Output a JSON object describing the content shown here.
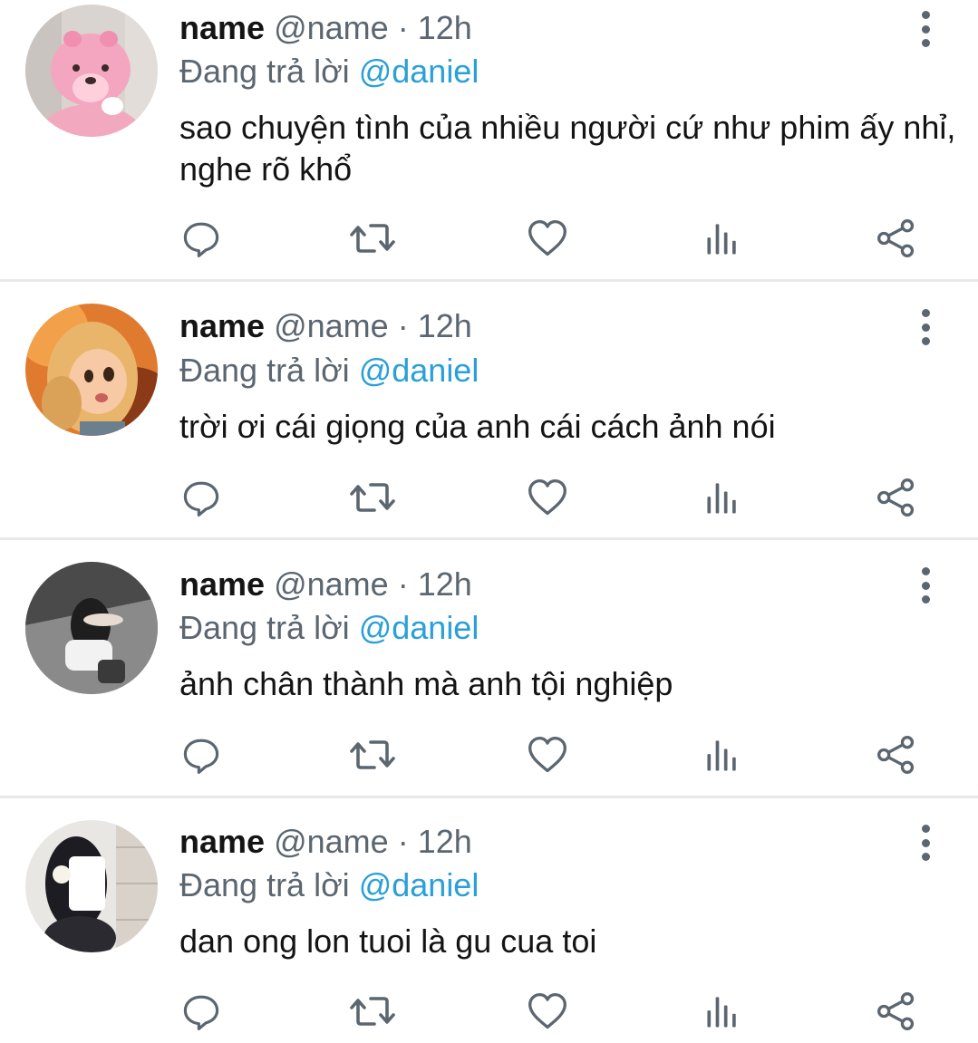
{
  "colors": {
    "name": "#141414",
    "secondary": "#5b6670",
    "mention": "#2a9fd8",
    "divider": "#e6e8ea",
    "icon": "#5b6670"
  },
  "actions": {
    "reply": "reply-icon",
    "retweet": "retweet-icon",
    "like": "heart-icon",
    "views": "views-icon",
    "share": "share-icon",
    "more": "more-vertical-icon"
  },
  "tweets": [
    {
      "name": "name",
      "handle": "@name",
      "separator": "·",
      "time": "12h",
      "reply_prefix": "Đang trả lời",
      "reply_to": "@daniel",
      "text": "sao chuyện tình của nhiều người cứ như phim ấy nhỉ, nghe rõ khổ"
    },
    {
      "name": "name",
      "handle": "@name",
      "separator": "·",
      "time": "12h",
      "reply_prefix": "Đang trả lời",
      "reply_to": "@daniel",
      "text": "trời ơi cái giọng của anh cái cách ảnh nói"
    },
    {
      "name": "name",
      "handle": "@name",
      "separator": "·",
      "time": "12h",
      "reply_prefix": "Đang trả lời",
      "reply_to": "@daniel",
      "text": "ảnh chân thành mà anh tội nghiệp"
    },
    {
      "name": "name",
      "handle": "@name",
      "separator": "·",
      "time": "12h",
      "reply_prefix": "Đang trả lời",
      "reply_to": "@daniel",
      "text": "dan ong lon tuoi là gu cua toi"
    }
  ]
}
